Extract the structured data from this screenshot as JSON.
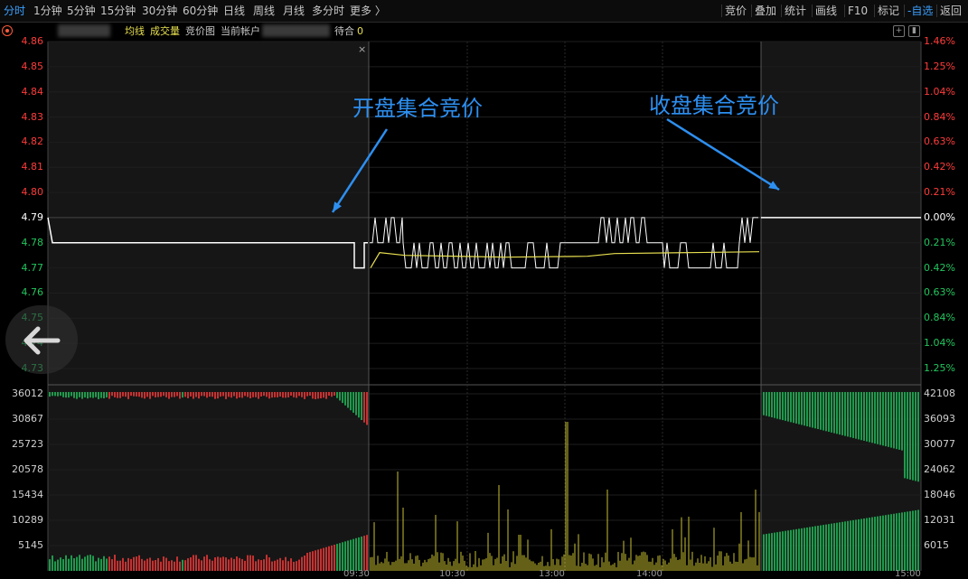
{
  "toolbar": {
    "left_items": [
      "分时",
      "1分钟",
      "5分钟",
      "15分钟",
      "30分钟",
      "60分钟",
      "日线",
      "周线",
      "月线",
      "多分时",
      "更多 〉"
    ],
    "active_item": "分时",
    "right_items": [
      "竞价",
      "叠加",
      "统计",
      "画线",
      "F10",
      "标记",
      "-自选",
      "返回"
    ]
  },
  "legend": {
    "items": [
      "均线",
      "成交量",
      "竞价图",
      "当前帐户",
      "待合"
    ],
    "count_value": "0",
    "colors": {
      "avg": "#e8e050",
      "volume": "#e8e050",
      "text": "#c8c8c8",
      "count": "#e8e050"
    }
  },
  "price_axis": {
    "left_labels": [
      "4.86",
      "4.85",
      "4.84",
      "4.83",
      "4.82",
      "4.81",
      "4.80",
      "4.79",
      "4.78",
      "4.77",
      "4.76",
      "4.75",
      "4.74",
      "4.73"
    ],
    "right_labels": [
      "1.46%",
      "1.25%",
      "1.04%",
      "0.84%",
      "0.63%",
      "0.42%",
      "0.21%",
      "0.00%",
      "0.21%",
      "0.42%",
      "0.63%",
      "0.84%",
      "1.04%",
      "1.25%"
    ],
    "prev_close": 4.79
  },
  "volume_axis": {
    "left_labels": [
      "36012",
      "30867",
      "25723",
      "20578",
      "15434",
      "10289",
      "5145"
    ],
    "right_labels": [
      "42108",
      "36093",
      "30077",
      "24062",
      "18046",
      "12031",
      "6015"
    ]
  },
  "time_axis": {
    "labels": [
      "09:30",
      "10:30",
      "13:00",
      "14:00",
      "15:00"
    ]
  },
  "annotations": {
    "open_auction": "开盘集合竞价",
    "close_auction": "收盘集合竞价"
  },
  "colors": {
    "up": "#ff3b3b",
    "down": "#22c55e",
    "flat": "#ffffff",
    "price_line": "#ffffff",
    "avg_line": "#e8e050",
    "annot": "#2d8ff0",
    "grid": "#2a2a2a"
  },
  "chart_data": {
    "type": "line",
    "title": "",
    "session_price": {
      "description_points": "price oscillating between 4.77 and 4.79 during continuous trading",
      "levels": [
        4.79,
        4.78,
        4.77
      ],
      "avg_line_start": 4.775,
      "avg_line_end": 4.78
    },
    "open_auction_price": [
      4.79,
      4.78,
      4.78,
      4.77
    ],
    "close_auction_price": [
      4.79,
      4.79
    ],
    "ylim": [
      4.73,
      4.86
    ],
    "volume_ylim": [
      0,
      36012
    ]
  }
}
